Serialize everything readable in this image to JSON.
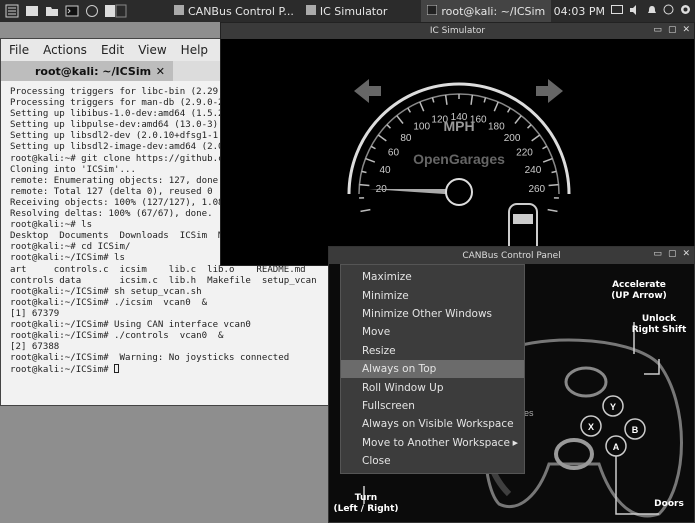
{
  "panel": {
    "tasks": [
      {
        "label": "CANBus Control P..."
      },
      {
        "label": "IC Simulator"
      },
      {
        "label": "root@kali: ~/ICSim"
      }
    ],
    "time": "04:03 PM"
  },
  "terminal": {
    "menu": [
      "File",
      "Actions",
      "Edit",
      "View",
      "Help"
    ],
    "tab_title": "root@kali: ~/ICSim",
    "tab_close": "✕",
    "lines": [
      "Processing triggers for libc-bin (2.29",
      "Processing triggers for man-db (2.9.0-2",
      "Setting up libibus-1.0-dev:amd64 (1.5.2",
      "Setting up libpulse-dev:amd64 (13.0-3)",
      "Setting up libsdl2-dev (2.0.10+dfsg1-1",
      "Setting up libsdl2-image-dev:amd64 (2.0",
      "root@kali:~# git clone https://github.c",
      "Cloning into 'ICSim'...",
      "remote: Enumerating objects: 127, done",
      "remote: Total 127 (delta 0), reused 0",
      "Receiving objects: 100% (127/127), 1.08",
      "Resolving deltas: 100% (67/67), done.",
      "root@kali:~# ls",
      "Desktop  Documents  Downloads  ICSim  M",
      "root@kali:~# cd ICSim/",
      "root@kali:~/ICSim# ls",
      "art     controls.c  icsim    lib.c  lib.o    README.md",
      "controls data       icsim.c  lib.h  Makefile  setup_vcan",
      "root@kali:~/ICSim# sh setup_vcan.sh",
      "root@kali:~/ICSim# ./icsim  vcan0  &",
      "[1] 67379",
      "root@kali:~/ICSim# Using CAN interface vcan0",
      "root@kali:~/ICSim# ./controls  vcan0  &",
      "[2] 67388",
      "root@kali:~/ICSim#  Warning: No joysticks connected",
      "root@kali:~/ICSim# "
    ]
  },
  "ic_window": {
    "title": "IC Simulator",
    "speed_ticks": [
      "20",
      "40",
      "60",
      "80",
      "100",
      "120",
      "140",
      "160",
      "180",
      "200",
      "220",
      "240",
      "260"
    ],
    "unit": "MPH",
    "brand": "OpenGarages"
  },
  "can_window": {
    "title": "CANBus Control Panel",
    "labels": {
      "accelerate": "Accelerate\n(UP Arrow)",
      "unlock": "Unlock\nRight Shift",
      "turn": "Turn\n(Left / Right)",
      "doors": "Doors",
      "partial": "ages"
    },
    "buttons": [
      "X",
      "Y",
      "B",
      "A"
    ]
  },
  "context_menu": {
    "items": [
      {
        "label": "Maximize"
      },
      {
        "label": "Minimize"
      },
      {
        "label": "Minimize Other Windows"
      },
      {
        "label": "Move"
      },
      {
        "label": "Resize"
      },
      {
        "label": "Always on Top"
      },
      {
        "label": "Roll Window Up"
      },
      {
        "label": "Fullscreen"
      },
      {
        "label": "Always on Visible Workspace"
      },
      {
        "label": "Move to Another Workspace"
      },
      {
        "label": "Close"
      }
    ],
    "highlighted": "Always on Top",
    "submenu_item": "Move to Another Workspace"
  }
}
